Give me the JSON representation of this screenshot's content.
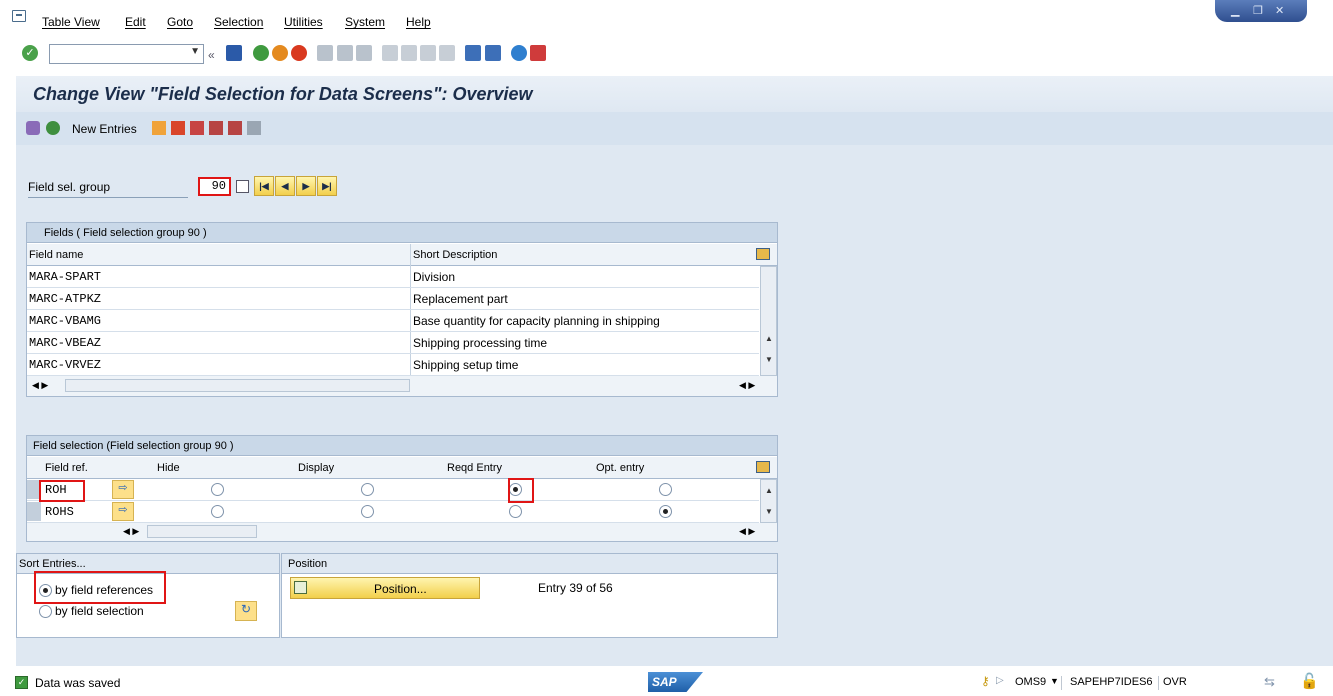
{
  "menu": {
    "items": [
      "Table View",
      "Edit",
      "Goto",
      "Selection",
      "Utilities",
      "System",
      "Help"
    ]
  },
  "title": "Change View \"Field Selection for Data Screens\": Overview",
  "app_toolbar": {
    "new_entries": "New Entries"
  },
  "header": {
    "field_sel_group_label": "Field sel. group",
    "field_sel_group_value": "90"
  },
  "fields_table": {
    "title": "Fields ( Field selection group  90 )",
    "columns": [
      "Field name",
      "Short Description"
    ],
    "rows": [
      {
        "field": "MARA-SPART",
        "desc": "Division"
      },
      {
        "field": "MARC-ATPKZ",
        "desc": "Replacement part"
      },
      {
        "field": "MARC-VBAMG",
        "desc": "Base quantity for capacity planning in shipping"
      },
      {
        "field": "MARC-VBEAZ",
        "desc": "Shipping processing time"
      },
      {
        "field": "MARC-VRVEZ",
        "desc": "Shipping setup time"
      }
    ]
  },
  "selection_table": {
    "title": "Field selection (Field selection group  90 )",
    "columns": [
      "Field ref.",
      "Hide",
      "Display",
      "Reqd Entry",
      "Opt. entry"
    ],
    "rows": [
      {
        "ref": "ROH",
        "selected": "Reqd Entry"
      },
      {
        "ref": "ROHS",
        "selected": "Opt. entry"
      }
    ]
  },
  "sort": {
    "title": "Sort Entries...",
    "options": [
      "by field references",
      "by field selection"
    ],
    "selected": "by field references"
  },
  "position": {
    "title": "Position",
    "button": "Position...",
    "entry_text": "Entry 39 of 56"
  },
  "status": {
    "message": "Data was saved",
    "transaction": "OMS9",
    "system": "SAPEHP7IDES6",
    "mode": "OVR",
    "logo": "SAP"
  }
}
